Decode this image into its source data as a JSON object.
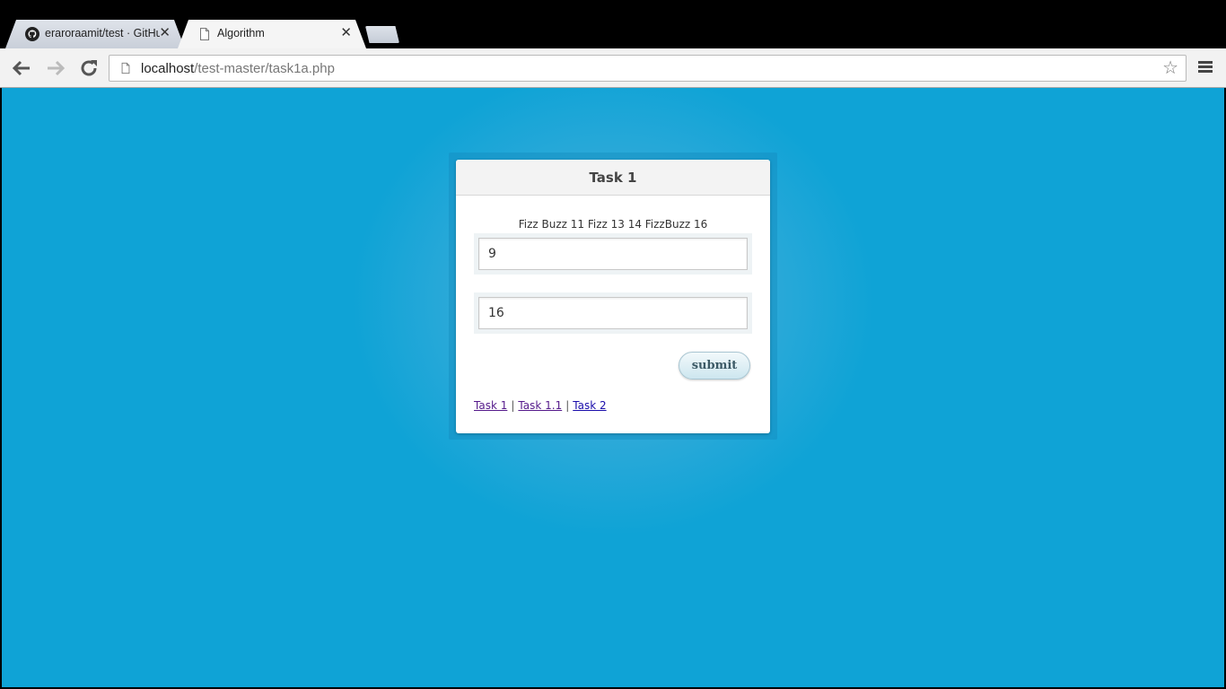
{
  "browser": {
    "tabs": [
      {
        "title": "eraroraamit/test · GitHu",
        "icon": "github-icon",
        "active": false
      },
      {
        "title": "Algorithm",
        "icon": "page-icon",
        "active": true
      }
    ],
    "close_glyph": "✕",
    "url_host": "localhost",
    "url_path": "/test-master/task1a.php",
    "star_glyph": "☆"
  },
  "page": {
    "card_title": "Task 1",
    "result_text": "Fizz Buzz 11 Fizz 13 14 FizzBuzz 16",
    "inputs": [
      {
        "value": "9"
      },
      {
        "value": "16"
      }
    ],
    "submit_label": "submit",
    "links": [
      "Task 1",
      "Task 1.1",
      "Task 2"
    ],
    "separator": "|"
  },
  "colors": {
    "background": "#0fa3d6",
    "link_visited": "#551a8b",
    "link_unvisited": "#1a0dab"
  }
}
